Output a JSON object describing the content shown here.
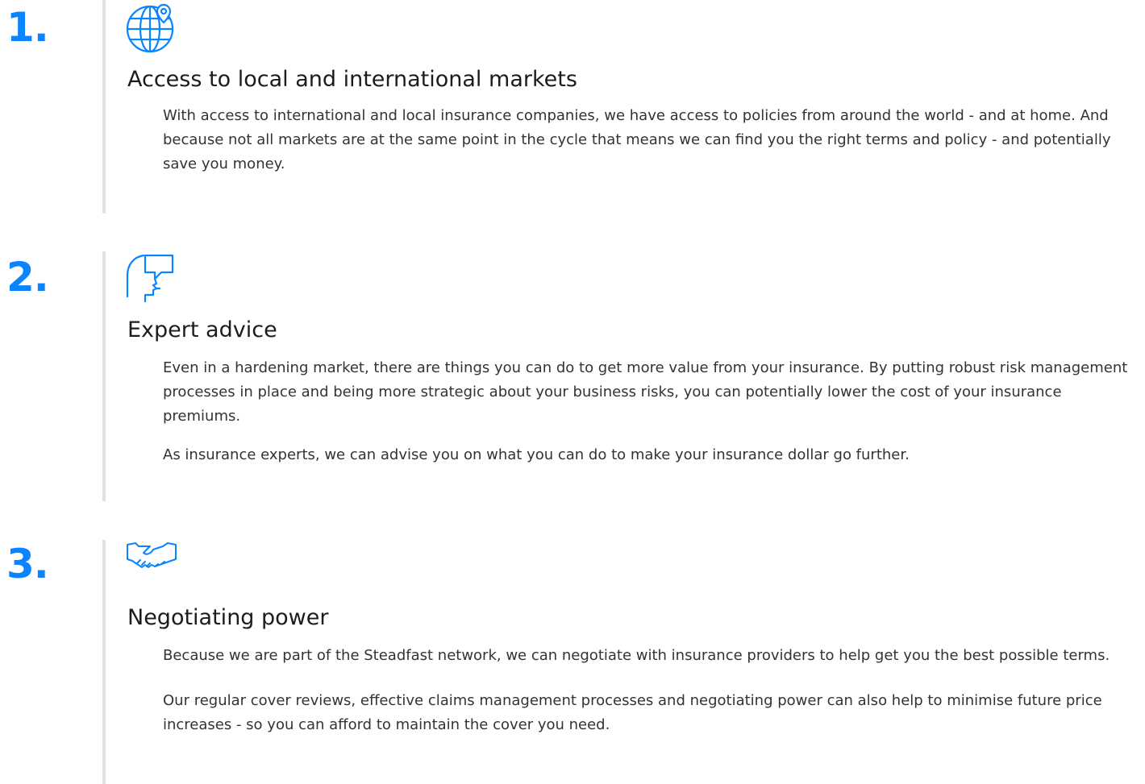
{
  "accent_color": "#0a84ff",
  "features": [
    {
      "number": "1.",
      "icon": "globe-location-icon",
      "title": "Access to local and international markets",
      "paragraphs": [
        "With access to international and local insurance companies, we have access to policies from around the world - and at home. And because not all markets are at the same point in the cycle that means we can find you the right terms and policy - and potentially save you money."
      ]
    },
    {
      "number": "2.",
      "icon": "expert-advice-head-icon",
      "title": "Expert advice",
      "paragraphs": [
        "Even in a hardening market, there are things you can do to get more value from your insurance. By putting robust risk management processes in place and being more strategic about your business risks, you can potentially lower the cost of your insurance premiums.",
        "As insurance experts, we can advise you on what you can do to make your insurance dollar go further."
      ]
    },
    {
      "number": "3.",
      "icon": "handshake-icon",
      "title": "Negotiating power",
      "paragraphs": [
        "Because we are part of the Steadfast network, we can negotiate with insurance providers to help get you the best possible terms.",
        "Our regular cover reviews, effective claims management processes and negotiating power can also help to minimise future price increases - so you can afford to maintain the cover you need."
      ]
    }
  ]
}
